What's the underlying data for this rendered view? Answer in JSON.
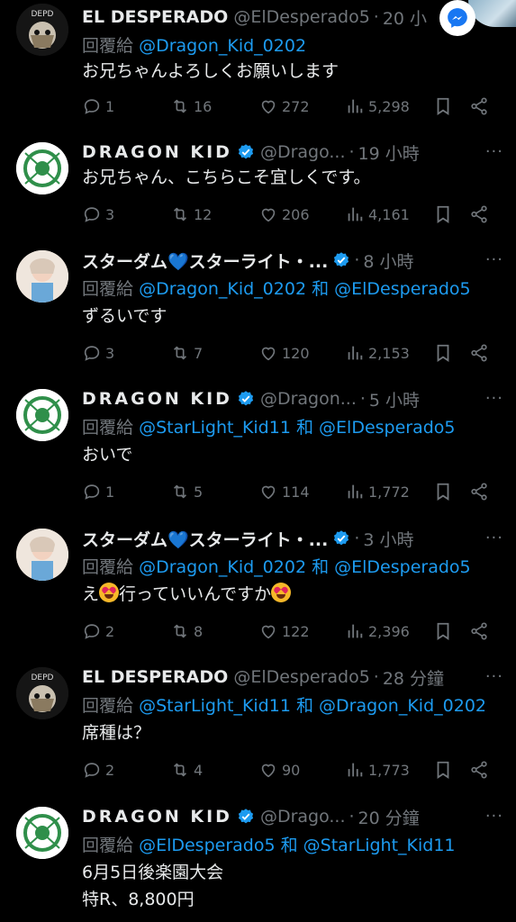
{
  "tweets": [
    {
      "name": "EL DESPERADO",
      "handle": "@ElDesperado5",
      "time": "20 小",
      "reply_prefix": "回覆給",
      "mentions": [
        "@Dragon_Kid_0202"
      ],
      "joiner": "",
      "body": [
        "お兄ちゃんよろしくお願いします"
      ],
      "replies": "1",
      "retweets": "16",
      "likes": "272",
      "views": "5,298"
    },
    {
      "name": "DRAGON KID",
      "handle": "@Drago...",
      "time": "19 小時",
      "body": [
        "お兄ちゃん、こちらこそ宜しくです。"
      ],
      "replies": "3",
      "retweets": "12",
      "likes": "206",
      "views": "4,161"
    },
    {
      "name": "スターダム💙スターライト・...",
      "handle": "",
      "time": "8 小時",
      "reply_prefix": "回覆給",
      "mentions": [
        "@Dragon_Kid_0202",
        "@ElDesperado5"
      ],
      "joiner": "和",
      "body": [
        "ずるいです"
      ],
      "replies": "3",
      "retweets": "7",
      "likes": "120",
      "views": "2,153"
    },
    {
      "name": "DRAGON KID",
      "handle": "@Dragon...",
      "time": "5 小時",
      "reply_prefix": "回覆給",
      "mentions": [
        "@StarLight_Kid11",
        "@ElDesperado5"
      ],
      "joiner": "和",
      "body": [
        "おいで"
      ],
      "replies": "1",
      "retweets": "5",
      "likes": "114",
      "views": "1,772"
    },
    {
      "name": "スターダム💙スターライト・...",
      "handle": "",
      "time": "3 小時",
      "reply_prefix": "回覆給",
      "mentions": [
        "@Dragon_Kid_0202",
        "@ElDesperado5"
      ],
      "joiner": "和",
      "body_parts": [
        "え",
        "行っていいんですか"
      ],
      "replies": "2",
      "retweets": "8",
      "likes": "122",
      "views": "2,396"
    },
    {
      "name": "EL DESPERADO",
      "handle": "@ElDesperado5",
      "time": "28 分鐘",
      "reply_prefix": "回覆給",
      "mentions": [
        "@StarLight_Kid11",
        "@Dragon_Kid_0202"
      ],
      "joiner": "和",
      "body": [
        "席種は？"
      ],
      "replies": "2",
      "retweets": "4",
      "likes": "90",
      "views": "1,773"
    },
    {
      "name": "DRAGON KID",
      "handle": "@Drago...",
      "time": "20 分鐘",
      "reply_prefix": "回覆給",
      "mentions": [
        "@ElDesperado5",
        "@StarLight_Kid11"
      ],
      "joiner": "和",
      "body": [
        "6月5日後楽園大会",
        "特R、8,800円"
      ]
    }
  ],
  "colors": {
    "background": "#000000",
    "text": "#e7e9ea",
    "muted": "#71767b",
    "link": "#1d9bf0"
  },
  "icons": [
    "reply-icon",
    "retweet-icon",
    "like-icon",
    "views-icon",
    "bookmark-icon",
    "share-icon",
    "verified-icon",
    "more-icon",
    "messenger-icon"
  ]
}
